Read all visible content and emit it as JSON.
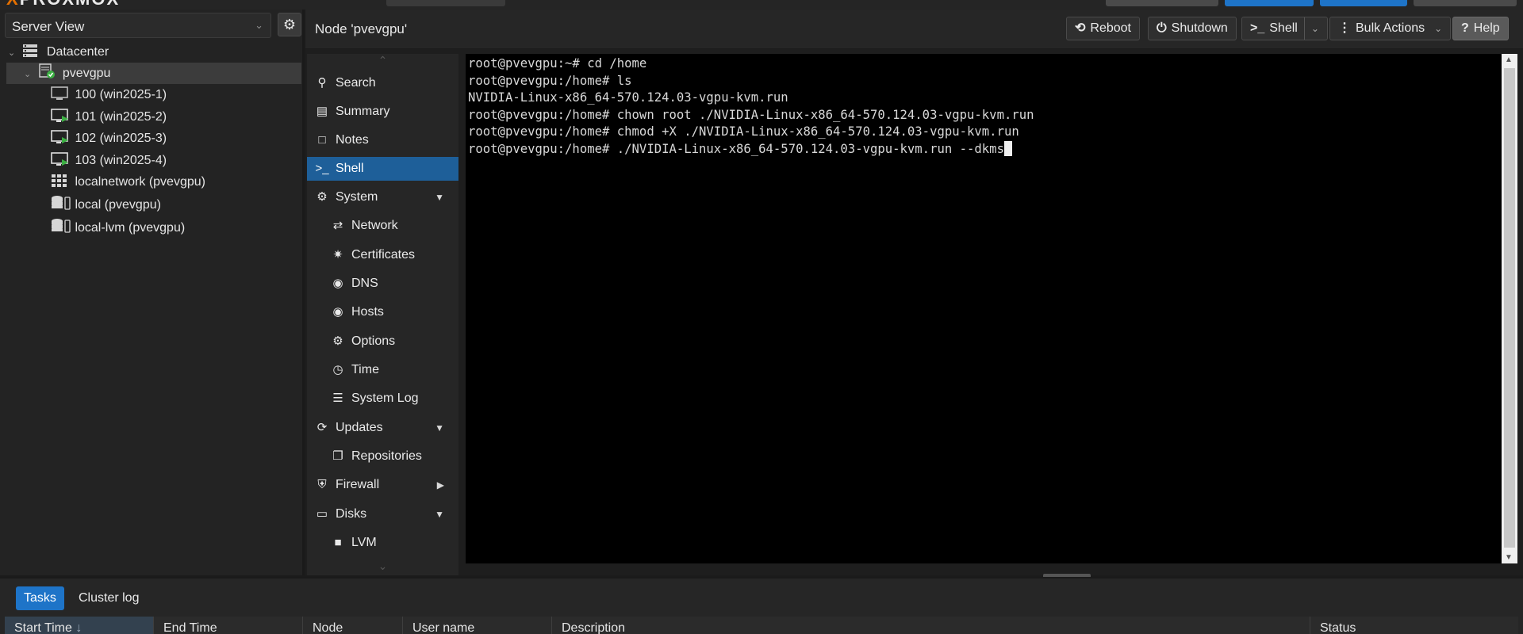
{
  "brand": {
    "logo_text_a": "X",
    "logo_text_b": "PROXMOX"
  },
  "left_panel": {
    "view_select": "Server View",
    "tree": [
      {
        "label": "Datacenter",
        "icon": "datacenter-icon",
        "level": 0
      },
      {
        "label": "pvevgpu",
        "icon": "node-online-icon",
        "level": 1
      },
      {
        "label": "100 (win2025-1)",
        "icon": "vm-stopped-icon",
        "level": 2
      },
      {
        "label": "101 (win2025-2)",
        "icon": "vm-running-icon",
        "level": 2
      },
      {
        "label": "102 (win2025-3)",
        "icon": "vm-running-icon",
        "level": 2
      },
      {
        "label": "103 (win2025-4)",
        "icon": "vm-running-icon",
        "level": 2
      },
      {
        "label": "localnetwork (pvevgpu)",
        "icon": "sdn-grid-icon",
        "level": 2
      },
      {
        "label": "local (pvevgpu)",
        "icon": "storage-icon",
        "level": 2
      },
      {
        "label": "local-lvm (pvevgpu)",
        "icon": "storage-icon",
        "level": 2
      }
    ]
  },
  "header": {
    "title": "Node 'pvevgpu'",
    "buttons": {
      "reboot": "Reboot",
      "shutdown": "Shutdown",
      "shell": "Shell",
      "bulk": "Bulk Actions",
      "help": "Help"
    }
  },
  "nav": {
    "items": [
      {
        "label": "Search",
        "icon": "search-icon"
      },
      {
        "label": "Summary",
        "icon": "book-icon"
      },
      {
        "label": "Notes",
        "icon": "notes-icon"
      },
      {
        "label": "Shell",
        "icon": "terminal-icon",
        "active": true
      },
      {
        "label": "System",
        "icon": "cogs-icon",
        "expander": "down"
      },
      {
        "label": "Network",
        "icon": "exchange-icon",
        "sub": true
      },
      {
        "label": "Certificates",
        "icon": "certificate-icon",
        "sub": true
      },
      {
        "label": "DNS",
        "icon": "globe-icon",
        "sub": true
      },
      {
        "label": "Hosts",
        "icon": "globe-icon",
        "sub": true
      },
      {
        "label": "Options",
        "icon": "gear-icon",
        "sub": true
      },
      {
        "label": "Time",
        "icon": "clock-icon",
        "sub": true
      },
      {
        "label": "System Log",
        "icon": "list-icon",
        "sub": true
      },
      {
        "label": "Updates",
        "icon": "refresh-icon",
        "expander": "down"
      },
      {
        "label": "Repositories",
        "icon": "files-icon",
        "sub": true
      },
      {
        "label": "Firewall",
        "icon": "shield-icon",
        "expander": "right"
      },
      {
        "label": "Disks",
        "icon": "hdd-icon",
        "expander": "down"
      },
      {
        "label": "LVM",
        "icon": "square-icon",
        "sub": true
      }
    ]
  },
  "terminal": {
    "lines": [
      "root@pvevgpu:~# cd /home",
      "root@pvevgpu:/home# ls",
      "NVIDIA-Linux-x86_64-570.124.03-vgpu-kvm.run",
      "root@pvevgpu:/home# chown root ./NVIDIA-Linux-x86_64-570.124.03-vgpu-kvm.run",
      "root@pvevgpu:/home# chmod +X ./NVIDIA-Linux-x86_64-570.124.03-vgpu-kvm.run",
      "root@pvevgpu:/home# ./NVIDIA-Linux-x86_64-570.124.03-vgpu-kvm.run --dkms"
    ]
  },
  "bottom": {
    "tabs": [
      "Tasks",
      "Cluster log"
    ],
    "columns": [
      "Start Time",
      "End Time",
      "Node",
      "User name",
      "Description",
      "Status"
    ]
  },
  "colors": {
    "accent": "#1e74c8",
    "active_nav": "#1e5f99",
    "brand_orange": "#e57000",
    "running_green": "#3cb043"
  }
}
